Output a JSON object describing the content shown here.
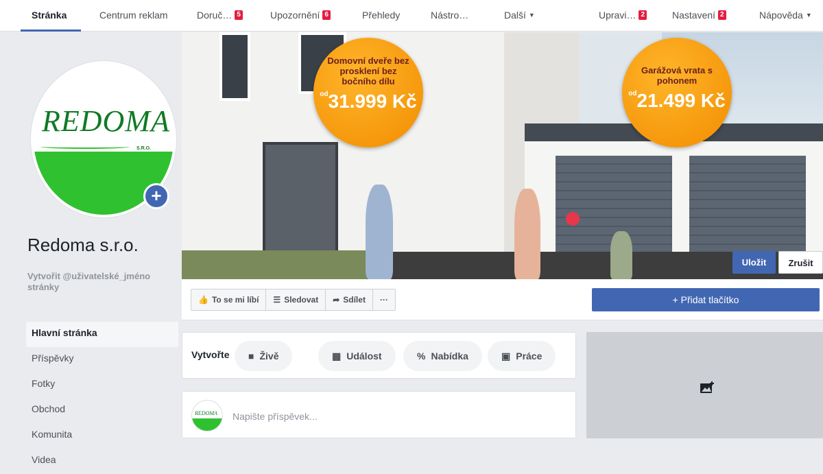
{
  "topnav": {
    "items": [
      {
        "label": "Stránka",
        "badge": ""
      },
      {
        "label": "Centrum reklam",
        "badge": ""
      },
      {
        "label": "Doruč…",
        "badge": "5"
      },
      {
        "label": "Upozornění",
        "badge": "6"
      },
      {
        "label": "Přehledy",
        "badge": ""
      },
      {
        "label": "Nástro…",
        "badge": ""
      },
      {
        "label": "Další",
        "badge": ""
      },
      {
        "label": "Upravi…",
        "badge": "2"
      },
      {
        "label": "Nastavení",
        "badge": "2"
      },
      {
        "label": "Nápověda",
        "badge": ""
      }
    ]
  },
  "profile": {
    "logo_text": "REDOMA",
    "logo_sub": "S.R.O.",
    "page_name": "Redoma s.r.o.",
    "username_prompt": "Vytvořit @uživatelské_jméno stránky"
  },
  "sidebar": {
    "items": [
      {
        "label": "Hlavní stránka"
      },
      {
        "label": "Příspěvky"
      },
      {
        "label": "Fotky"
      },
      {
        "label": "Obchod"
      },
      {
        "label": "Komunita"
      },
      {
        "label": "Videa"
      }
    ]
  },
  "cover": {
    "promo1": {
      "title": "Domovní dveře bez prosklení bez bočního dílu",
      "prefix": "od",
      "price": "31.999 Kč"
    },
    "promo2": {
      "title": "Garážová vrata s pohonem",
      "prefix": "od",
      "price": "21.499 Kč"
    },
    "save_label": "Uložit",
    "cancel_label": "Zrušit"
  },
  "actions": {
    "like": "To se mi líbí",
    "follow": "Sledovat",
    "share": "Sdílet",
    "more": "···",
    "add_button": "+ Přidat tlačítko"
  },
  "create": {
    "label": "Vytvořte",
    "live": "Živě",
    "event": "Událost",
    "offer": "Nabídka",
    "job": "Práce"
  },
  "post": {
    "logo_text": "REDOMA",
    "placeholder": "Napište příspěvek..."
  },
  "colors": {
    "accent": "#4267b2",
    "badge": "#e41e3f",
    "promo": "#f5a000",
    "logo_green": "#2fc12f"
  }
}
